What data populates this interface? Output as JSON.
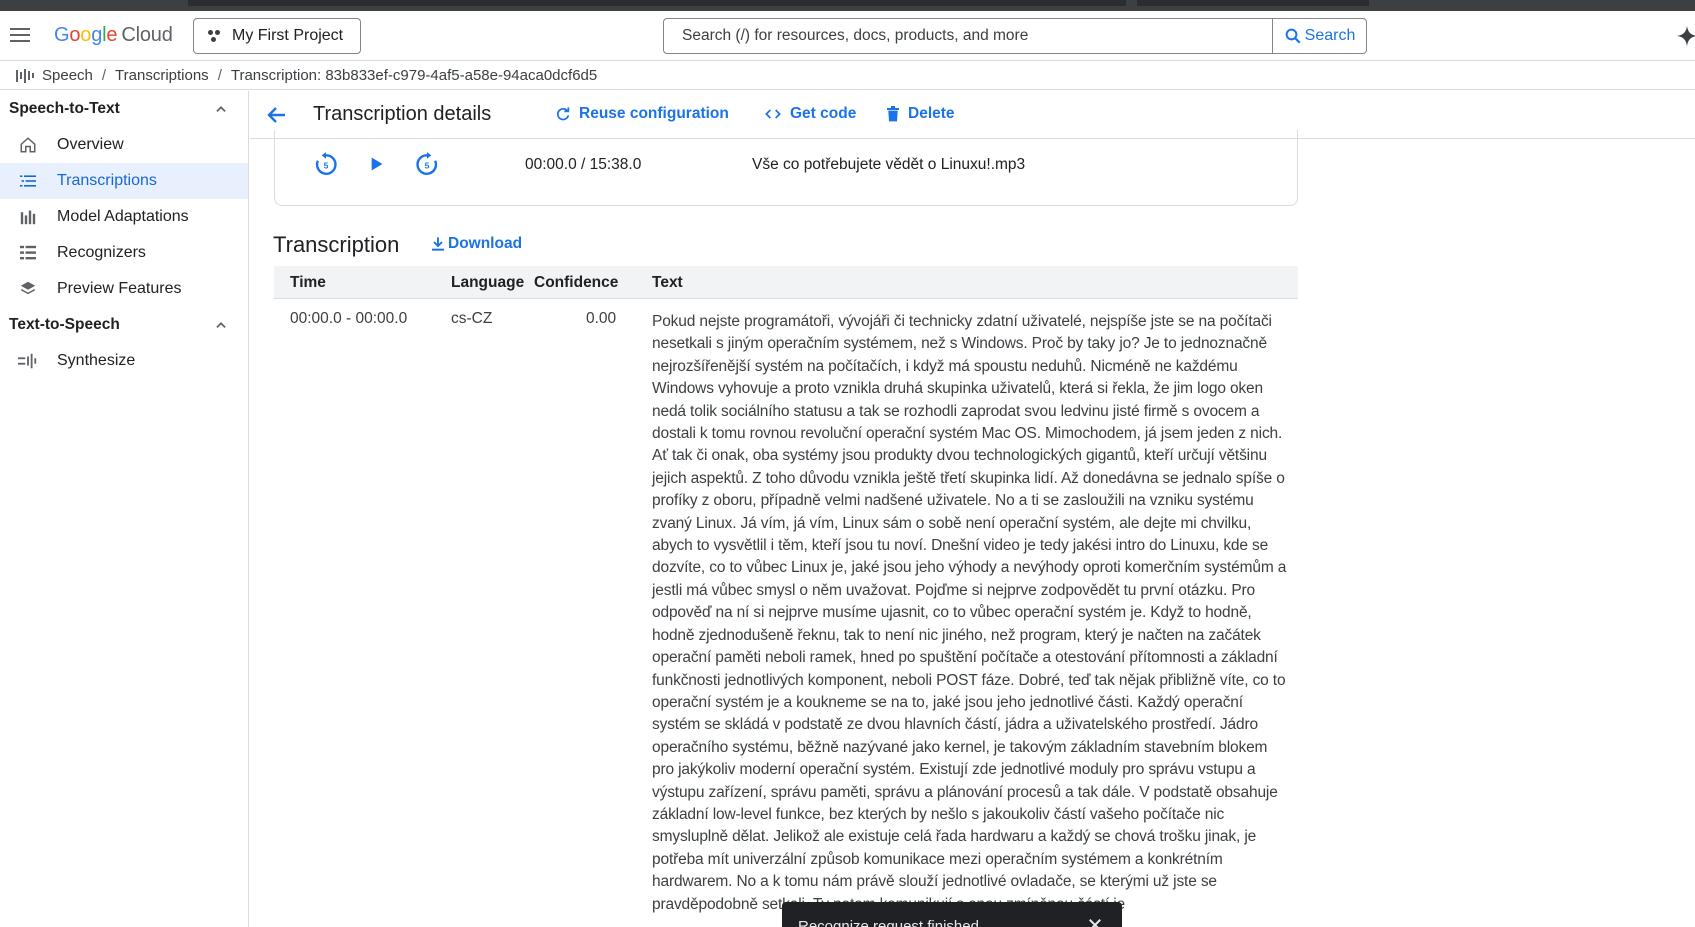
{
  "header": {
    "logo_google": "Google",
    "logo_cloud": "Cloud",
    "project_name": "My First Project",
    "search_placeholder": "Search (/) for resources, docs, products, and more",
    "search_button": "Search"
  },
  "breadcrumb": {
    "items": [
      "Speech",
      "Transcriptions",
      "Transcription: 83b833ef-c979-4af5-a58e-94aca0dcf6d5"
    ],
    "separator": "/"
  },
  "sidebar": {
    "sections": [
      {
        "title": "Speech-to-Text",
        "items": [
          {
            "label": "Overview",
            "icon": "home-icon"
          },
          {
            "label": "Transcriptions",
            "icon": "list-icon",
            "active": true
          },
          {
            "label": "Model Adaptations",
            "icon": "bar-chart-icon"
          },
          {
            "label": "Recognizers",
            "icon": "checklist-icon"
          },
          {
            "label": "Preview Features",
            "icon": "layers-icon"
          }
        ]
      },
      {
        "title": "Text-to-Speech",
        "items": [
          {
            "label": "Synthesize",
            "icon": "audio-wave-icon"
          }
        ]
      }
    ]
  },
  "titlebar": {
    "title": "Transcription details",
    "reuse": "Reuse configuration",
    "get_code": "Get code",
    "delete": "Delete"
  },
  "player": {
    "time": "00:00.0 / 15:38.0",
    "filename": "Vše co potřebujete vědět o Linuxu!.mp3"
  },
  "transcription": {
    "title": "Transcription",
    "download": "Download",
    "columns": [
      "Time",
      "Language",
      "Confidence",
      "Text"
    ],
    "rows": [
      {
        "time": "00:00.0 - 00:00.0",
        "language": "cs-CZ",
        "confidence": "0.00",
        "text": "Pokud nejste programátoři, vývojáři či technicky zdatní uživatelé, nejspíše jste se na počítači nesetkali s jiným operačním systémem, než s Windows. Proč by taky jo? Je to jednoznačně nejrozšířenější systém na počítačích, i když má spoustu neduhů. Nicméně ne každému Windows vyhovuje a proto vznikla druhá skupinka uživatelů, která si řekla, že jim logo oken nedá tolik sociálního statusu a tak se rozhodli zaprodat svou ledvinu jisté firmě s ovocem a dostali k tomu rovnou revoluční operační systém Mac OS. Mimochodem, já jsem jeden z nich. Ať tak či onak, oba systémy jsou produkty dvou technologických gigantů, kteří určují většinu jejich aspektů. Z toho důvodu vznikla ještě třetí skupinka lidí. Až donedávna se jednalo spíše o profíky z oboru, případně velmi nadšené uživatele. No a ti se zasloužili na vzniku systému zvaný Linux. Já vím, já vím, Linux sám o sobě není operační systém, ale dejte mi chvilku, abych to vysvětlil i těm, kteří jsou tu noví. Dnešní video je tedy jakési intro do Linuxu, kde se dozvíte, co to vůbec Linux je, jaké jsou jeho výhody a nevýhody oproti komerčním systémům a jestli má vůbec smysl o něm uvažovat. Pojďme si nejprve zodpovědět tu první otázku. Pro odpověď na ní si nejprve musíme ujasnit, co to vůbec operační systém je. Když to hodně, hodně zjednodušeně řeknu, tak to není nic jiného, než program, který je načten na začátek operační paměti neboli ramek, hned po spuštění počítače a otestování přítomnosti a základní funkčnosti jednotlivých komponent, neboli POST fáze. Dobré, teď tak nějak přibližně víte, co to operační systém je a koukneme se na to, jaké jsou jeho jednotlivé části. Každý operační systém se skládá v podstatě ze dvou hlavních částí, jádra a uživatelského prostředí. Jádro operačního systému, běžně nazývané jako kernel, je takovým základním stavebním blokem pro jakýkoliv moderní operační systém. Existují zde jednotlivé moduly pro správu vstupu a výstupu zařízení, správu paměti, správu a plánování procesů a tak dále. V podstatě obsahuje základní low-level funkce, bez kterých by nešlo s jakoukoliv částí vašeho počítače nic smysluplně dělat. Jelikož ale existuje celá řada hardwaru a každý se chová trošku jinak, je potřeba mít univerzální způsob komunikace mezi operačním systémem a konkrétním hardwarem. No a k tomu nám právě slouží jednotlivé ovladače, se kterými už jste se pravděpodobně setkali. Ty potom komunikují s onou zmíněnou částí je"
      }
    ]
  },
  "snackbar": {
    "message": "Recognize request finished"
  },
  "colors": {
    "accent": "#1a73e8",
    "active_bg": "#e8f0fe",
    "border": "#dadce0"
  }
}
